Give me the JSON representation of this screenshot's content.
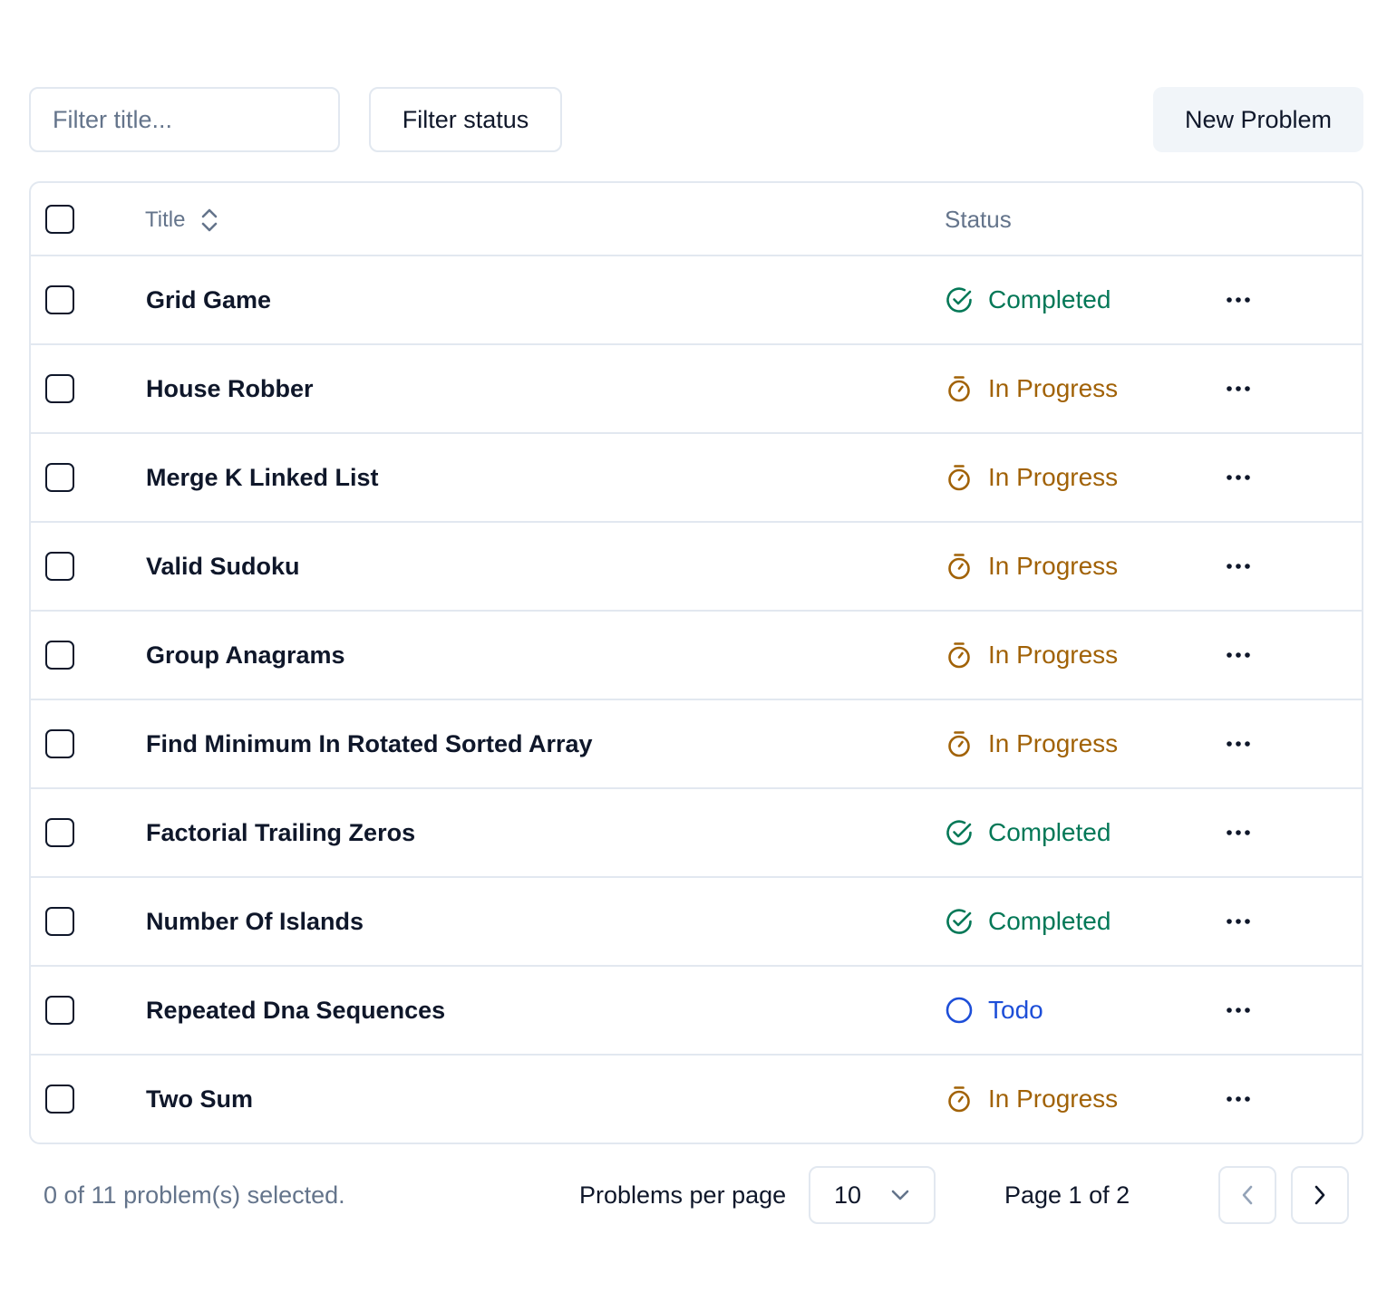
{
  "toolbar": {
    "filter_placeholder": "Filter title...",
    "filter_status_label": "Filter status",
    "new_problem_label": "New Problem"
  },
  "table": {
    "columns": {
      "title": "Title",
      "status": "Status"
    },
    "rows": [
      {
        "title": "Grid Game",
        "status": "Completed"
      },
      {
        "title": "House Robber",
        "status": "In Progress"
      },
      {
        "title": "Merge K Linked List",
        "status": "In Progress"
      },
      {
        "title": "Valid Sudoku",
        "status": "In Progress"
      },
      {
        "title": "Group Anagrams",
        "status": "In Progress"
      },
      {
        "title": "Find Minimum In Rotated Sorted Array",
        "status": "In Progress"
      },
      {
        "title": "Factorial Trailing Zeros",
        "status": "Completed"
      },
      {
        "title": "Number Of Islands",
        "status": "Completed"
      },
      {
        "title": "Repeated Dna Sequences",
        "status": "Todo"
      },
      {
        "title": "Two Sum",
        "status": "In Progress"
      }
    ]
  },
  "footer": {
    "selected_text": "0 of 11 problem(s) selected.",
    "per_page_label": "Problems per page",
    "per_page_value": "10",
    "page_text": "Page 1 of 2"
  },
  "colors": {
    "completed": "#047857",
    "in_progress": "#a16207",
    "todo": "#1d4ed8",
    "border": "#e2e8f0",
    "muted": "#64748b"
  }
}
